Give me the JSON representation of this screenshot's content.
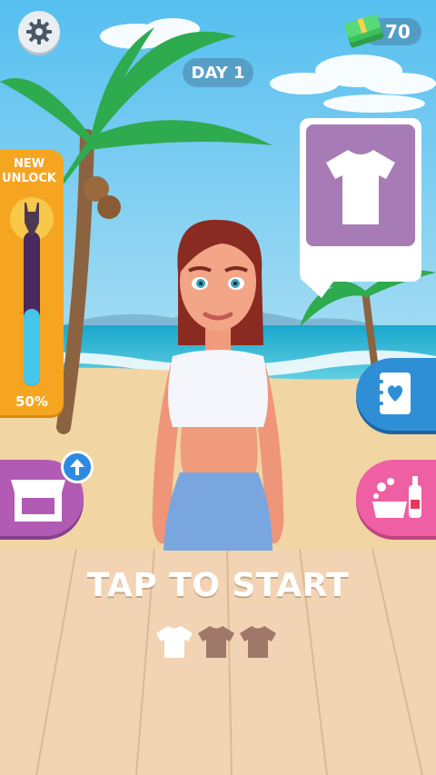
{
  "hud": {
    "cash_value": "70",
    "day_label": "DAY 1"
  },
  "unlock": {
    "title_line1": "NEW",
    "title_line2": "UNLOCK",
    "progress_label": "50%",
    "progress": 0.5
  },
  "prompt": {
    "tap_to_start": "TAP TO START"
  },
  "shirt_progress": {
    "total": 3,
    "completed": 1
  },
  "icons": {
    "settings": "gear-icon",
    "cash": "money-stack-icon",
    "unlock_item": "swimsuit-icon",
    "current_item": "tshirt-icon",
    "journal": "heart-notebook-icon",
    "wash": "laundry-basin-icon",
    "shop": "store-icon",
    "upgrade": "arrow-up-icon"
  },
  "colors": {
    "sky": "#6ac7ef",
    "sea": "#2bb9d8",
    "sand": "#f1d5a3",
    "table": "#f2d4b4",
    "accent_orange": "#f6a521",
    "card_purple": "#a77bb5",
    "shop_purple": "#b25bb4",
    "journal_blue": "#2f8fd6",
    "wash_pink": "#ef5fa3",
    "shirt_done": "#ffffff",
    "shirt_pending": "#a0786a"
  }
}
